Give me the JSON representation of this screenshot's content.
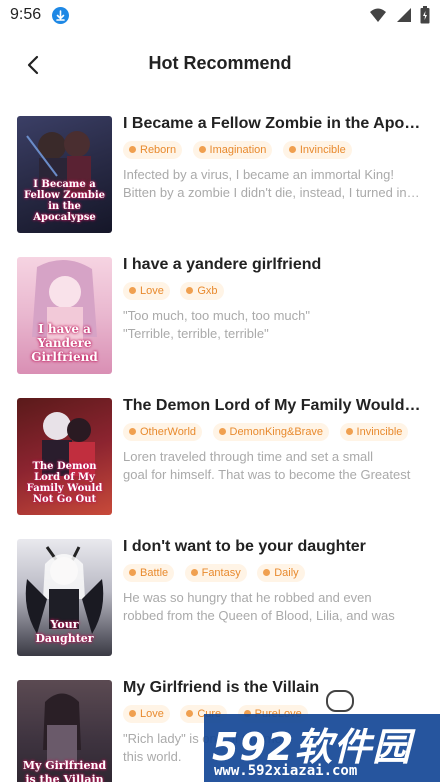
{
  "status_bar": {
    "time": "9:56"
  },
  "header": {
    "title": "Hot Recommend"
  },
  "books": [
    {
      "cover_text": "I Became a Fellow Zombie in the Apocalypse",
      "title": "I Became a Fellow Zombie in the Apocalypse",
      "tags": [
        "Reborn",
        "Imagination",
        "Invincible"
      ],
      "desc_lines": [
        "Infected by a virus, I  became an immortal King!",
        "Bitten by a zombie I didn't die, instead, I turned into one"
      ]
    },
    {
      "cover_text": "I have a Yandere Girlfriend",
      "title": "I have a yandere girlfriend",
      "tags": [
        "Love",
        "Gxb"
      ],
      "desc_lines": [
        "\"Too much, too much, too much\"",
        "\"Terrible, terrible, terrible\""
      ]
    },
    {
      "cover_text": "The Demon Lord of My Family Would Not Go Out",
      "title": "The Demon Lord of My Family Would Not Go Out",
      "tags": [
        "OtherWorld",
        "DemonKing&Brave",
        "Invincible"
      ],
      "desc_lines": [
        "Loren traveled through time and set a small",
        "goal for himself. That was to become the Greatest"
      ]
    },
    {
      "cover_text": "Your Daughter",
      "title": "I don't want to be your daughter",
      "tags": [
        "Battle",
        "Fantasy",
        "Daily"
      ],
      "desc_lines": [
        "He was so hungry that he robbed and even",
        "robbed from the Queen of  Blood, Lilia, and was"
      ]
    },
    {
      "cover_text": "My Girlfriend is the Villain",
      "title": "My Girlfriend is the Villain",
      "tags": [
        "Love",
        "Cure",
        "PureLove"
      ],
      "desc_lines": [
        "\"Rich lady\" is one of the most",
        "this world."
      ]
    }
  ],
  "watermark": {
    "main": "592软件园",
    "url": "www.592xiazai.com"
  },
  "colors": {
    "accent": "#e88a2e",
    "tag_bg": "#fff4e6",
    "desc": "#aaaaaa",
    "download": "#1e88e5"
  },
  "icons": {
    "back": "chevron-left-icon",
    "download": "download-icon",
    "wifi": "wifi-icon",
    "signal": "signal-icon",
    "battery": "battery-icon",
    "tag": "tag-dot-icon"
  }
}
